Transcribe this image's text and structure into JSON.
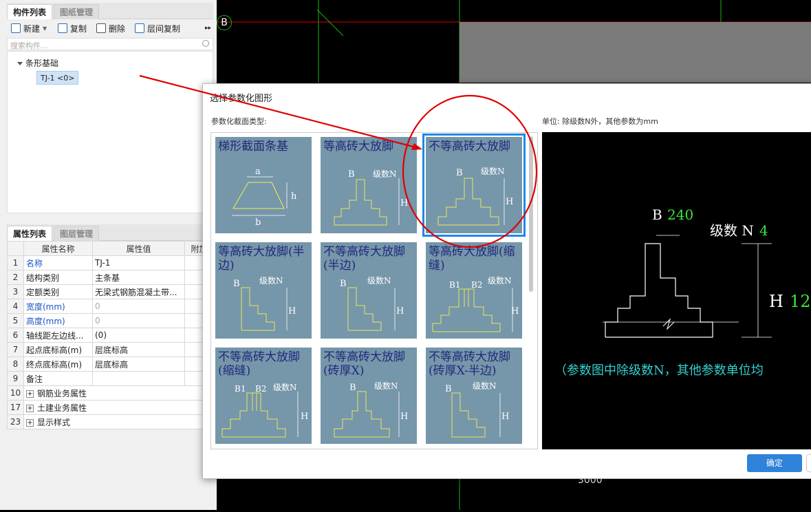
{
  "left": {
    "tabs_top": [
      "构件列表",
      "图纸管理"
    ],
    "toolbar": {
      "new": "新建",
      "copy": "复制",
      "delete": "删除",
      "floor_copy": "层间复制",
      "more": "▸▸"
    },
    "search_placeholder": "搜索构件...",
    "tree": {
      "group": "条形基础",
      "item": "TJ-1 <0>"
    },
    "tabs_bottom": [
      "属性列表",
      "图层管理"
    ],
    "props": {
      "headers": [
        "属性名称",
        "属性值",
        "附加"
      ],
      "rows": [
        {
          "n": "1",
          "name": "名称",
          "value": "TJ-1",
          "blue": true,
          "check": false
        },
        {
          "n": "2",
          "name": "结构类别",
          "value": "主条基",
          "blue": false,
          "check": true
        },
        {
          "n": "3",
          "name": "定额类别",
          "value": "无梁式钢筋混凝土带...",
          "blue": false,
          "check": true
        },
        {
          "n": "4",
          "name": "宽度(mm)",
          "value": "0",
          "blue": true,
          "check": true,
          "gray": true
        },
        {
          "n": "5",
          "name": "高度(mm)",
          "value": "0",
          "blue": true,
          "check": true,
          "gray": true
        },
        {
          "n": "6",
          "name": "轴线距左边线...",
          "value": "(0)",
          "blue": false,
          "check": true
        },
        {
          "n": "7",
          "name": "起点底标高(m)",
          "value": "层底标高",
          "blue": false,
          "check": true
        },
        {
          "n": "8",
          "name": "终点底标高(m)",
          "value": "层底标高",
          "blue": false,
          "check": true
        },
        {
          "n": "9",
          "name": "备注",
          "value": "",
          "blue": false,
          "check": true
        }
      ],
      "groups": [
        {
          "n": "10",
          "name": "钢筋业务属性"
        },
        {
          "n": "17",
          "name": "土建业务属性"
        },
        {
          "n": "23",
          "name": "显示样式"
        }
      ]
    }
  },
  "cad": {
    "axis": "B",
    "dim": "3000"
  },
  "dialog": {
    "title": "选择参数化图形",
    "section_label": "参数化截面类型:",
    "unit_label": "单位:   除级数N外，其他参数为mm",
    "ok": "确定",
    "cells": [
      {
        "title": "梯形截面条基",
        "a": "a",
        "b": "b",
        "h": "h"
      },
      {
        "title": "等高砖大放脚",
        "B": "B",
        "N": "级数N",
        "H": "H"
      },
      {
        "title": "不等高砖大放脚",
        "B": "B",
        "N": "级数N",
        "H": "H"
      },
      {
        "title": "等高砖大放脚(半边)",
        "B": "B",
        "N": "级数N",
        "H": "H"
      },
      {
        "title": "不等高砖大放脚(半边)",
        "B": "B",
        "N": "级数N",
        "H": "H"
      },
      {
        "title": "等高砖大放脚(缩缝)",
        "B": "B1",
        "B2": "B2",
        "N": "级数N",
        "H": "H"
      },
      {
        "title": "不等高砖大放脚(缩缝)",
        "B": "B1",
        "B2": "B2",
        "N": "级数N",
        "H": "H"
      },
      {
        "title": "不等高砖大放脚(砖厚X)",
        "B": "B",
        "N": "级数N",
        "H": "H"
      },
      {
        "title": "不等高砖大放脚(砖厚X-半边)",
        "B": "B",
        "N": "级数N",
        "H": "H"
      }
    ],
    "preview": {
      "B": "B",
      "B_val": "240",
      "N": "级数 N",
      "N_val": "4",
      "H": "H",
      "H_val": "12",
      "note": "（参数图中除级数N，其他参数单位均"
    }
  },
  "colors": {
    "accent": "#2f82d9",
    "annotation": "#e00000",
    "thumb_bg": "#7696aa",
    "dim_green": "#39e639",
    "note_cyan": "#33d0d0"
  }
}
